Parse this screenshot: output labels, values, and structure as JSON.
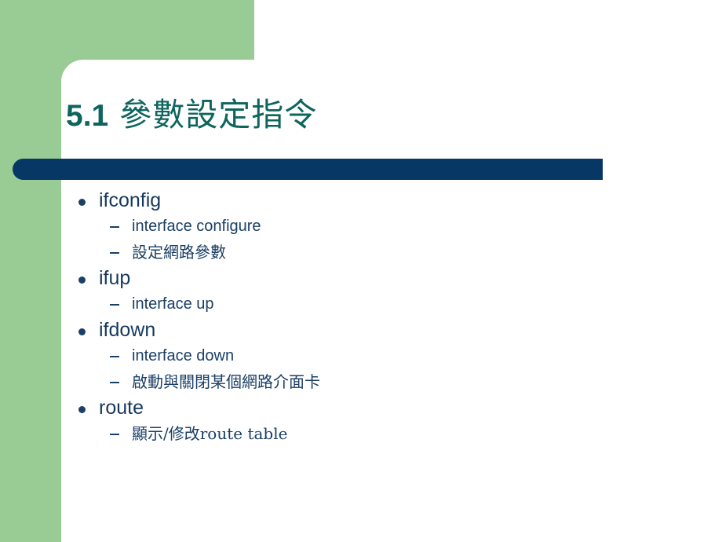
{
  "slide": {
    "title_number": "5.1",
    "title_text": "參數設定指令",
    "colors": {
      "accent_green": "#99CB95",
      "bar_navy": "#073765",
      "title_teal": "#0E655E",
      "body_navy": "#16395E",
      "background": "#FFFFFF"
    },
    "content": [
      {
        "label": "ifconfig",
        "sub": [
          {
            "label": "interface configure",
            "script": "latin"
          },
          {
            "label": "設定網路參數",
            "script": "cjk"
          }
        ]
      },
      {
        "label": "ifup",
        "sub": [
          {
            "label": "interface up",
            "script": "latin"
          }
        ]
      },
      {
        "label": "ifdown",
        "sub": [
          {
            "label": "interface down",
            "script": "latin"
          },
          {
            "label": "啟動與關閉某個網路介面卡",
            "script": "cjk"
          }
        ]
      },
      {
        "label": "route",
        "sub": [
          {
            "label": "顯示/修改route table",
            "script": "cjk"
          }
        ]
      }
    ]
  }
}
